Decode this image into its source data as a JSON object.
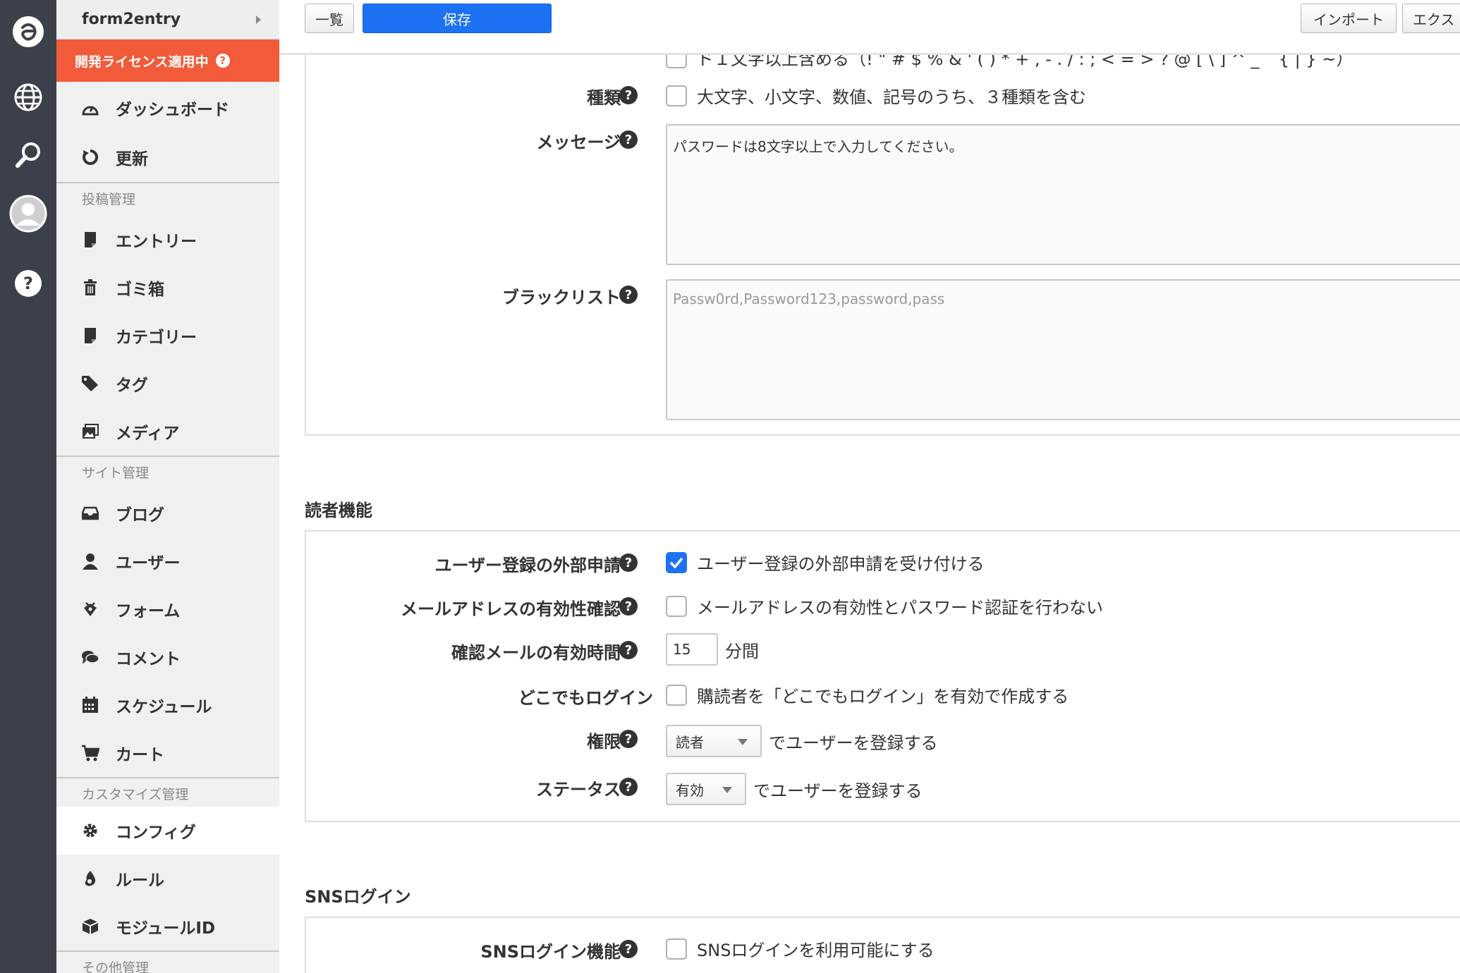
{
  "rail": {
    "icons": [
      "acms-logo-icon",
      "globe-icon",
      "search-icon",
      "user-avatar-icon",
      "help-icon"
    ]
  },
  "sidebar": {
    "site_name": "form2entry",
    "license_badge": "開発ライセンス適用中",
    "license_help": "?",
    "top_items": [
      {
        "label": "ダッシュボード",
        "icon": "dashboard-icon"
      },
      {
        "label": "更新",
        "icon": "refresh-icon"
      }
    ],
    "groups": [
      {
        "heading": "投稿管理",
        "items": [
          {
            "label": "エントリー",
            "icon": "entry-icon"
          },
          {
            "label": "ゴミ箱",
            "icon": "trash-icon"
          },
          {
            "label": "カテゴリー",
            "icon": "category-icon"
          },
          {
            "label": "タグ",
            "icon": "tag-icon"
          },
          {
            "label": "メディア",
            "icon": "media-icon"
          }
        ]
      },
      {
        "heading": "サイト管理",
        "items": [
          {
            "label": "ブログ",
            "icon": "blog-icon"
          },
          {
            "label": "ユーザー",
            "icon": "user-icon"
          },
          {
            "label": "フォーム",
            "icon": "form-icon"
          },
          {
            "label": "コメント",
            "icon": "comment-icon"
          },
          {
            "label": "スケジュール",
            "icon": "calendar-icon"
          },
          {
            "label": "カート",
            "icon": "cart-icon"
          }
        ]
      },
      {
        "heading": "カスタマイズ管理",
        "items": [
          {
            "label": "コンフィグ",
            "icon": "gear-icon",
            "active": true
          },
          {
            "label": "ルール",
            "icon": "rule-icon"
          },
          {
            "label": "モジュールID",
            "icon": "module-icon"
          }
        ]
      },
      {
        "heading": "その他管理",
        "items": []
      }
    ]
  },
  "toolbar": {
    "list_label": "一覧",
    "save_label": "保存",
    "import_label": "インポート",
    "export_label": "エクス"
  },
  "password_panel": {
    "cut_row_text": "ド１文字以上含める（! \" # $ % & ' ( ) * + , - . / : ; < = > ? @ [ \\ ] ^ _ ` { | } ~）",
    "kind_label": "種類",
    "kind_checkbox": "大文字、小文字、数値、記号のうち、３種類を含む",
    "message_label": "メッセージ",
    "message_value": "パスワードは8文字以上で入力してください。",
    "blacklist_label": "ブラックリスト",
    "blacklist_placeholder": "Passw0rd,Password123,password,pass",
    "help_glyph": "?"
  },
  "reader_section": {
    "title": "読者機能",
    "rows": {
      "external_label": "ユーザー登録の外部申請",
      "external_text": "ユーザー登録の外部申請を受け付ける",
      "external_checked": true,
      "email_label": "メールアドレスの有効性確認",
      "email_text": "メールアドレスの有効性とパスワード認証を行わない",
      "expire_label": "確認メールの有効時間",
      "expire_value": "15",
      "expire_unit": "分間",
      "anywhere_label": "どこでもログイン",
      "anywhere_text": "購読者を「どこでもログイン」を有効で作成する",
      "auth_label": "権限",
      "auth_value": "読者",
      "auth_suffix": "でユーザーを登録する",
      "status_label": "ステータス",
      "status_value": "有効",
      "status_suffix": "でユーザーを登録する"
    }
  },
  "sns_section": {
    "title": "SNSログイン",
    "feature_label": "SNSログイン機能",
    "feature_text": "SNSログインを利用可能にする"
  },
  "colors": {
    "rail_bg": "#3c404a",
    "license_bg": "#f25b3a",
    "primary_blue": "#1d72f3"
  }
}
